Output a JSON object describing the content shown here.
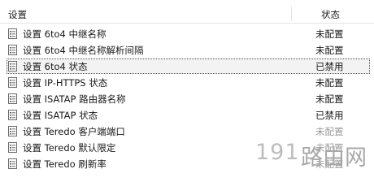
{
  "columns": {
    "name": "设置",
    "state": "状态"
  },
  "rows": [
    {
      "name": "设置 6to4 中继名称",
      "state": "未配置",
      "selected": false,
      "faded": false
    },
    {
      "name": "设置 6to4 中继名称解析间隔",
      "state": "未配置",
      "selected": false,
      "faded": false
    },
    {
      "name": "设置 6to4 状态",
      "state": "已禁用",
      "selected": true,
      "faded": false
    },
    {
      "name": "设置 IP-HTTPS 状态",
      "state": "未配置",
      "selected": false,
      "faded": false
    },
    {
      "name": "设置 ISATAP 路由器名称",
      "state": "未配置",
      "selected": false,
      "faded": false
    },
    {
      "name": "设置 ISATAP 状态",
      "state": "已禁用",
      "selected": false,
      "faded": false
    },
    {
      "name": "设置 Teredo 客户端端口",
      "state": "未配置",
      "selected": false,
      "faded": true
    },
    {
      "name": "设置 Teredo 默认限定",
      "state": "未配置",
      "selected": false,
      "faded": true
    },
    {
      "name": "设置 Teredo 刷新率",
      "state": "未配置",
      "selected": false,
      "faded": true
    }
  ],
  "icon": "policy-setting-icon",
  "watermark": {
    "number": "191",
    "text": "路由网"
  }
}
